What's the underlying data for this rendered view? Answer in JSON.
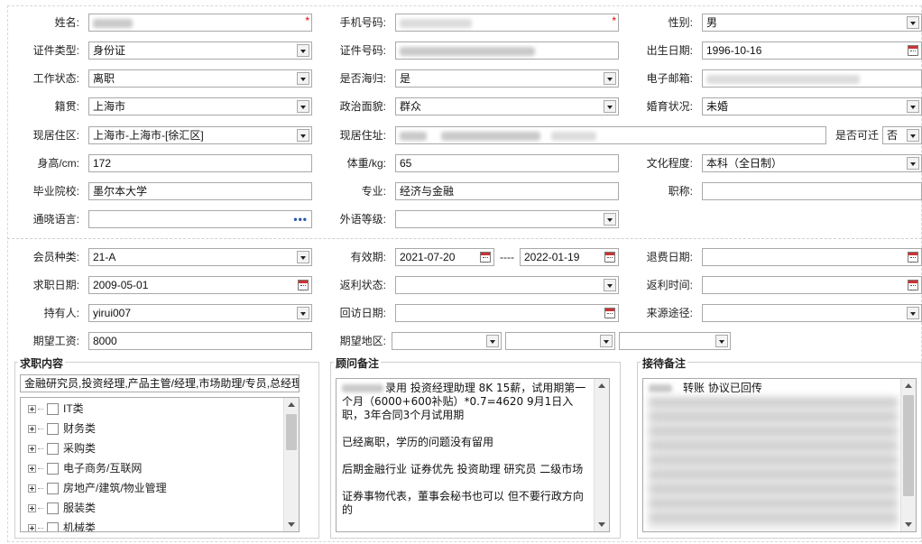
{
  "row1": {
    "name_label": "姓名:",
    "phone_label": "手机号码:",
    "gender_label": "性别:",
    "gender_value": "男",
    "required_mark": "*"
  },
  "row2": {
    "id_type_label": "证件类型:",
    "id_type_value": "身份证",
    "id_no_label": "证件号码:",
    "birth_label": "出生日期:",
    "birth_value": "1996-10-16"
  },
  "row3": {
    "work_status_label": "工作状态:",
    "work_status_value": "离职",
    "returnee_label": "是否海归:",
    "returnee_value": "是",
    "email_label": "电子邮箱:"
  },
  "row4": {
    "native_label": "籍贯:",
    "native_value": "上海市",
    "political_label": "政治面貌:",
    "political_value": "群众",
    "marital_label": "婚育状况:",
    "marital_value": "未婚"
  },
  "row5": {
    "residence_label": "现居住区:",
    "residence_value": "上海市-上海市-[徐汇区]",
    "address_label": "现居住址:",
    "relocate_label": "是否可迁",
    "relocate_value": "否"
  },
  "row6": {
    "height_label": "身高/cm:",
    "height_value": "172",
    "weight_label": "体重/kg:",
    "weight_value": "65",
    "education_label": "文化程度:",
    "education_value": "本科（全日制）"
  },
  "row7": {
    "school_label": "毕业院校:",
    "school_value": "墨尔本大学",
    "major_label": "专业:",
    "major_value": "经济与金融",
    "title_label": "职称:"
  },
  "row8": {
    "language_label": "通晓语言:",
    "foreign_level_label": "外语等级:",
    "more_glyph": "•••"
  },
  "member": {
    "type_label": "会员种类:",
    "type_value": "21-A",
    "valid_label": "有效期:",
    "valid_from": "2021-07-20",
    "valid_sep": "----",
    "valid_to": "2022-01-19",
    "refund_date_label": "退费日期:",
    "job_date_label": "求职日期:",
    "job_date_value": "2009-05-01",
    "rebate_status_label": "返利状态:",
    "rebate_time_label": "返利时间:",
    "holder_label": "持有人:",
    "holder_value": "yirui007",
    "visit_date_label": "回访日期:",
    "source_label": "来源途径:",
    "salary_label": "期望工资:",
    "salary_value": "8000",
    "region_label": "期望地区:"
  },
  "job_content": {
    "legend": "求职内容",
    "summary": "金融研究员,投资经理,产品主管/经理,市场助理/专员,总经理",
    "items": [
      "IT类",
      "财务类",
      "采购类",
      "电子商务/互联网",
      "房地产/建筑/物业管理",
      "服装类",
      "机械类"
    ]
  },
  "consultant": {
    "legend": "顾问备注",
    "p1": "录用 投资经理助理 8K 15薪，试用期第一个月（6000+600补贴）*0.7=4620  9月1日入职，3年合同3个月试用期",
    "p2": "已经离职，学历的问题没有留用",
    "p3": "后期金融行业 证券优先  投资助理  研究员 二级市场",
    "p4": "证券事物代表，董事会秘书也可以 但不要行政方向的"
  },
  "reception": {
    "legend": "接待备注",
    "line1": "转账 协议已回传"
  }
}
